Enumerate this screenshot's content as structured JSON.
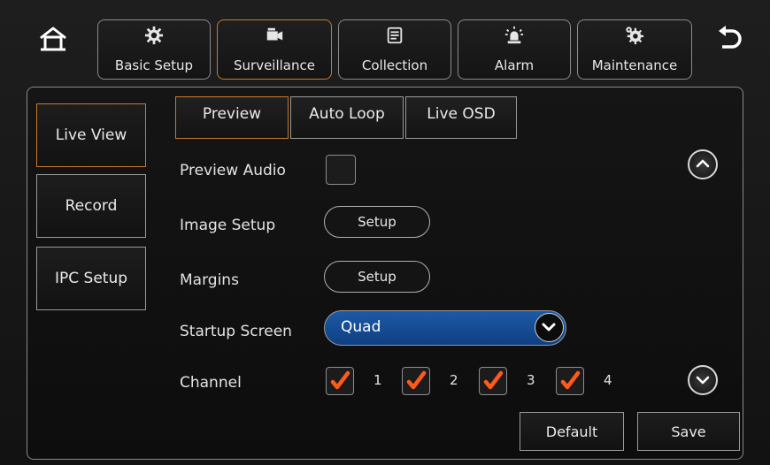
{
  "nav": {
    "tabs": [
      {
        "label": "Basic Setup",
        "icon": "gear-icon"
      },
      {
        "label": "Surveillance",
        "icon": "camera-icon"
      },
      {
        "label": "Collection",
        "icon": "document-icon"
      },
      {
        "label": "Alarm",
        "icon": "alarm-light-icon"
      },
      {
        "label": "Maintenance",
        "icon": "gears-icon"
      }
    ],
    "active_tab": "Surveillance"
  },
  "sidebar": {
    "items": [
      {
        "label": "Live View"
      },
      {
        "label": "Record"
      },
      {
        "label": "IPC Setup"
      }
    ],
    "active_item": "Live View"
  },
  "subtabs": {
    "items": [
      {
        "label": "Preview"
      },
      {
        "label": "Auto Loop"
      },
      {
        "label": "Live OSD"
      }
    ],
    "active": "Preview"
  },
  "form": {
    "preview_audio_label": "Preview Audio",
    "preview_audio_checked": false,
    "image_setup_label": "Image Setup",
    "image_setup_button": "Setup",
    "margins_label": "Margins",
    "margins_button": "Setup",
    "startup_screen_label": "Startup Screen",
    "startup_screen_value": "Quad",
    "channel_label": "Channel",
    "channels": [
      {
        "num": "1",
        "checked": true
      },
      {
        "num": "2",
        "checked": true
      },
      {
        "num": "3",
        "checked": true
      },
      {
        "num": "4",
        "checked": true
      }
    ]
  },
  "actions": {
    "default_label": "Default",
    "save_label": "Save"
  },
  "colors": {
    "accent_orange": "#c97a2a",
    "select_blue": "#1d5aa6",
    "check_orange": "#ff5a1a"
  }
}
